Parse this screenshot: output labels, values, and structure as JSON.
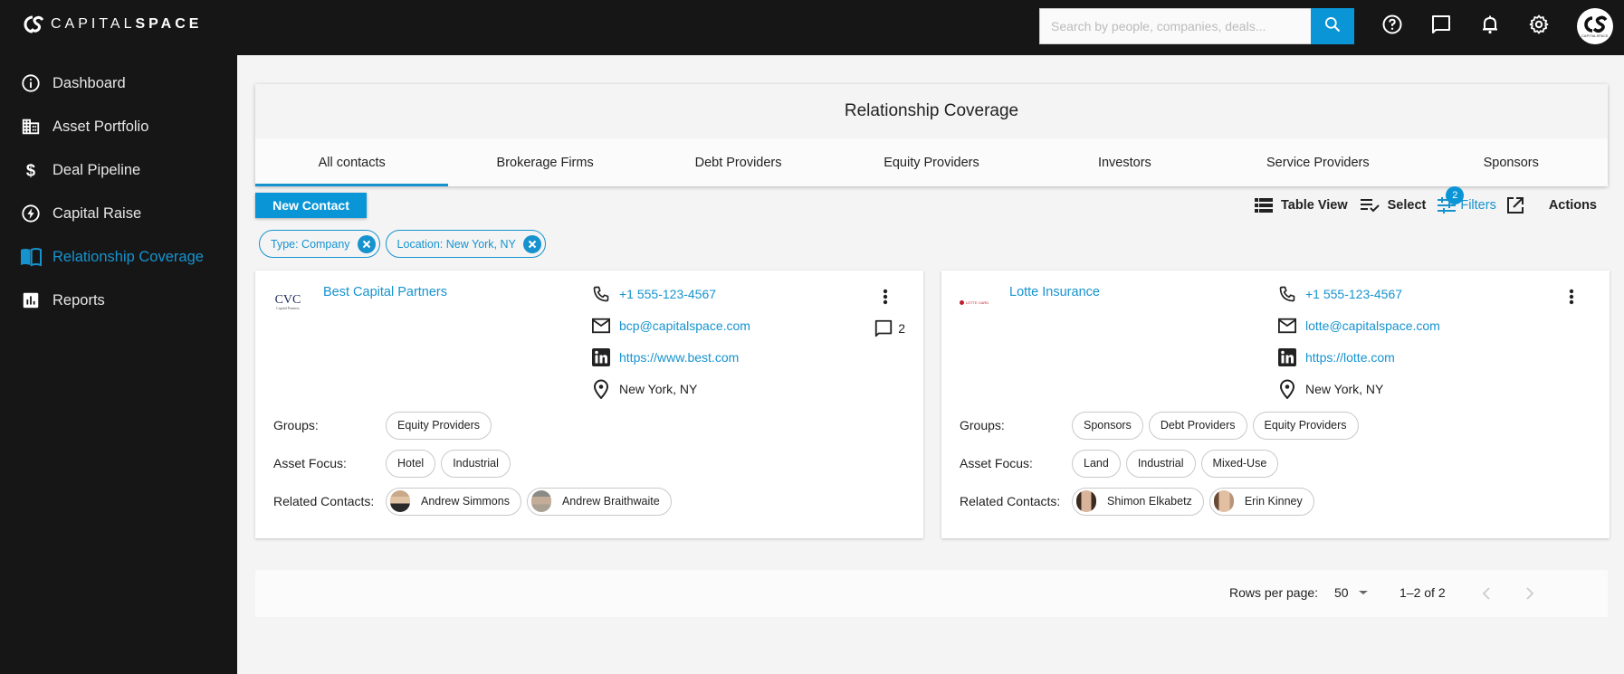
{
  "app": {
    "logo_text_light": "CAPITAL",
    "logo_text_bold": "SPACE",
    "avatar_caption": "CAPITALSPACE"
  },
  "topbar": {
    "search_placeholder": "Search by people, companies, deals...",
    "search_value": "",
    "icons": [
      "help-icon",
      "chat-icon",
      "bell-icon",
      "gear-icon"
    ]
  },
  "sidebar": {
    "items": [
      {
        "label": "Dashboard",
        "icon": "info-icon",
        "active": false
      },
      {
        "label": "Asset Portfolio",
        "icon": "building-icon",
        "active": false
      },
      {
        "label": "Deal Pipeline",
        "icon": "dollar-icon",
        "active": false
      },
      {
        "label": "Capital Raise",
        "icon": "bolt-icon",
        "active": false
      },
      {
        "label": "Relationship Coverage",
        "icon": "book-icon",
        "active": true
      },
      {
        "label": "Reports",
        "icon": "bar-chart-icon",
        "active": false
      }
    ]
  },
  "header": {
    "title": "Relationship Coverage",
    "tabs": [
      {
        "label": "All contacts",
        "active": true
      },
      {
        "label": "Brokerage Firms",
        "active": false
      },
      {
        "label": "Debt Providers",
        "active": false
      },
      {
        "label": "Equity Providers",
        "active": false
      },
      {
        "label": "Investors",
        "active": false
      },
      {
        "label": "Service Providers",
        "active": false
      },
      {
        "label": "Sponsors",
        "active": false
      }
    ]
  },
  "toolbar": {
    "new_contact_label": "New Contact",
    "table_view_label": "Table View",
    "select_label": "Select",
    "filters_label": "Filters",
    "filters_count": "2",
    "actions_label": "Actions"
  },
  "active_filters": [
    {
      "label": "Type: Company"
    },
    {
      "label": "Location: New York, NY"
    }
  ],
  "cards": [
    {
      "name": "Best Capital Partners",
      "logo_text": "CVC",
      "logo_subtext": "Capital Partners",
      "phone": "+1 555-123-4567",
      "email": "bcp@capitalspace.com",
      "website": "https://www.best.com",
      "location": "New York, NY",
      "comments_count": "2",
      "groups_label": "Groups:",
      "groups": [
        "Equity Providers"
      ],
      "asset_focus_label": "Asset Focus:",
      "asset_focus": [
        "Hotel",
        "Industrial"
      ],
      "related_label": "Related Contacts:",
      "related_contacts": [
        "Andrew Simmons",
        "Andrew Braithwaite"
      ]
    },
    {
      "name": "Lotte Insurance",
      "logo_text": "LOTTE CARD",
      "logo_subtext": "",
      "phone": "+1 555-123-4567",
      "email": "lotte@capitalspace.com",
      "website": "https://lotte.com",
      "location": "New York, NY",
      "comments_count": "",
      "groups_label": "Groups:",
      "groups": [
        "Sponsors",
        "Debt Providers",
        "Equity Providers"
      ],
      "asset_focus_label": "Asset Focus:",
      "asset_focus": [
        "Land",
        "Industrial",
        "Mixed-Use"
      ],
      "related_label": "Related Contacts:",
      "related_contacts": [
        "Shimon Elkabetz",
        "Erin Kinney"
      ]
    }
  ],
  "pagination": {
    "rows_per_page_label": "Rows per page:",
    "rows_per_page_value": "50",
    "range_label": "1–2 of 2"
  },
  "colors": {
    "accent": "#0a96d6",
    "link": "#1693cf",
    "topbar_bg": "#161616"
  }
}
